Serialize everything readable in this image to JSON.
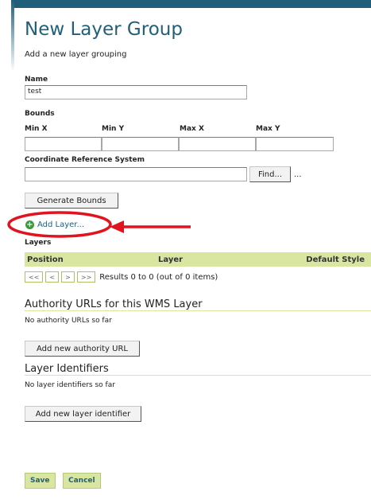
{
  "page": {
    "title": "New Layer Group",
    "subtitle": "Add a new layer grouping"
  },
  "form": {
    "name_label": "Name",
    "name_value": "test",
    "bounds_label": "Bounds",
    "minx_label": "Min X",
    "miny_label": "Min Y",
    "maxx_label": "Max X",
    "maxy_label": "Max Y",
    "crs_label": "Coordinate Reference System",
    "find_label": "Find...",
    "find_ellipsis": "...",
    "generate_bounds_label": "Generate Bounds",
    "add_layer_label": "Add Layer..."
  },
  "layers": {
    "title": "Layers",
    "columns": [
      "Position",
      "Layer",
      "Default Style"
    ],
    "pager_buttons": [
      "<<",
      "<",
      ">",
      ">>"
    ],
    "results_text": "Results 0 to 0 (out of 0 items)"
  },
  "authority": {
    "heading": "Authority URLs for this WMS Layer",
    "empty_text": "No authority URLs so far",
    "add_label": "Add new authority URL"
  },
  "identifiers": {
    "heading": "Layer Identifiers",
    "empty_text": "No layer identifiers so far",
    "add_label": "Add new layer identifier"
  },
  "actions": {
    "save_label": "Save",
    "cancel_label": "Cancel"
  },
  "colors": {
    "accent": "#1f5f7a",
    "table_header": "#d8e6a2",
    "annotation": "#e0141e"
  }
}
